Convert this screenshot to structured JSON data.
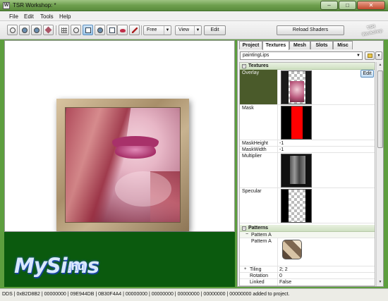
{
  "window": {
    "title": "TSR Workshop: *",
    "icon_letter": "W",
    "controls": [
      "–",
      "□",
      "✕"
    ]
  },
  "menu": [
    "File",
    "Edit",
    "Tools",
    "Help"
  ],
  "toolbar": {
    "mode_select": "Free",
    "view_select": "View",
    "edit_label": "Edit",
    "reload_label": "Reload Shaders",
    "logo_text": "TSR Workshop"
  },
  "tabs": [
    "Project",
    "Textures",
    "Mesh",
    "Slots",
    "Misc"
  ],
  "active_tab": "Textures",
  "material_select": "paintingLips",
  "properties": {
    "textures_header": "Textures",
    "overlay_label": "Overlay",
    "edit_label": "Edit",
    "mask_label": "Mask",
    "mask_height_label": "MaskHeight",
    "mask_height_value": "-1",
    "mask_width_label": "MaskWidth",
    "mask_width_value": "-1",
    "multiplier_label": "Multiplier",
    "specular_label": "Specular",
    "patterns_header": "Patterns",
    "pattern_a_header": "Pattern A",
    "pattern_a_label": "Pattern A",
    "tiling_label": "Tiling",
    "tiling_value": "2; 2",
    "rotation_label": "Rotation",
    "rotation_value": "0",
    "linked_label": "Linked",
    "linked_value": "False"
  },
  "watermark": {
    "brand": "MySims",
    "suffix": ".hu"
  },
  "status": "DDS | 0xB2D8B2 | 00000000 | 09E944DB | 0B30F4A4 | 00000000 | 00000000 | 00000000 | 00000000 | 00000000 added to project.",
  "colors": {
    "window_chrome": "#6e9f4e",
    "viewport_bg": "#ffffff",
    "ground_green": "#0b5a0e",
    "mask_red": "#ff0000"
  }
}
